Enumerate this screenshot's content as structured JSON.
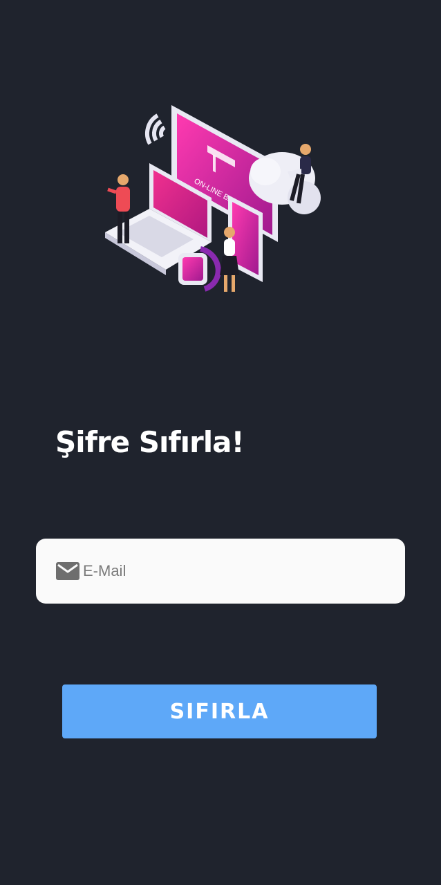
{
  "page": {
    "title": "Şifre Sıfırla!",
    "background": "#1f232d"
  },
  "illustration": {
    "screen_label": "ON-LINE BANKING",
    "accent_color": "#e91e8c"
  },
  "email": {
    "placeholder": "E-Mail",
    "value": "",
    "icon": "mail-icon"
  },
  "reset_button": {
    "label": "SIFIRLA",
    "color": "#5ea8f8"
  }
}
